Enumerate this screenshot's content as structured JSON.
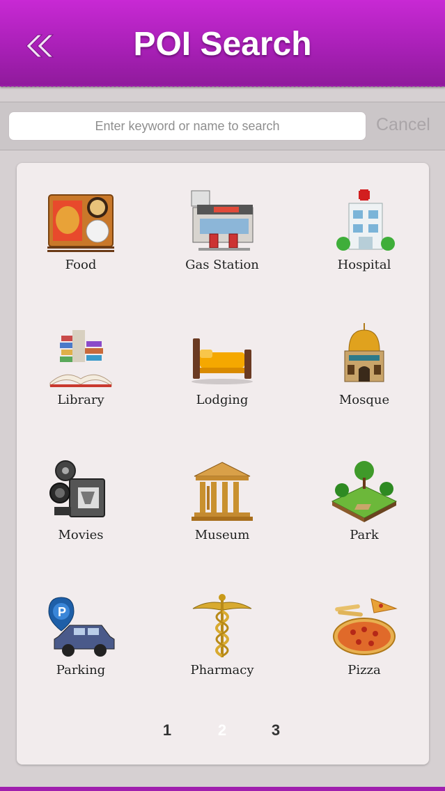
{
  "header": {
    "title": "POI Search",
    "back_icon": "double-chevron-left-icon",
    "color_top": "#c829d4",
    "color_bottom": "#8f1a9b"
  },
  "search": {
    "placeholder": "Enter keyword or name to search",
    "value": "",
    "cancel_label": "Cancel"
  },
  "categories": [
    {
      "label": "Food",
      "icon": "food-tray-icon"
    },
    {
      "label": "Gas Station",
      "icon": "gas-station-icon"
    },
    {
      "label": "Hospital",
      "icon": "hospital-icon"
    },
    {
      "label": "Library",
      "icon": "library-books-icon"
    },
    {
      "label": "Lodging",
      "icon": "bed-icon"
    },
    {
      "label": "Mosque",
      "icon": "mosque-icon"
    },
    {
      "label": "Movies",
      "icon": "movie-camera-icon"
    },
    {
      "label": "Museum",
      "icon": "museum-icon"
    },
    {
      "label": "Park",
      "icon": "park-icon"
    },
    {
      "label": "Parking",
      "icon": "parking-car-icon"
    },
    {
      "label": "Pharmacy",
      "icon": "caduceus-icon"
    },
    {
      "label": "Pizza",
      "icon": "pizza-icon"
    }
  ],
  "pagination": {
    "pages": [
      "1",
      "2",
      "3"
    ],
    "current": "2"
  }
}
